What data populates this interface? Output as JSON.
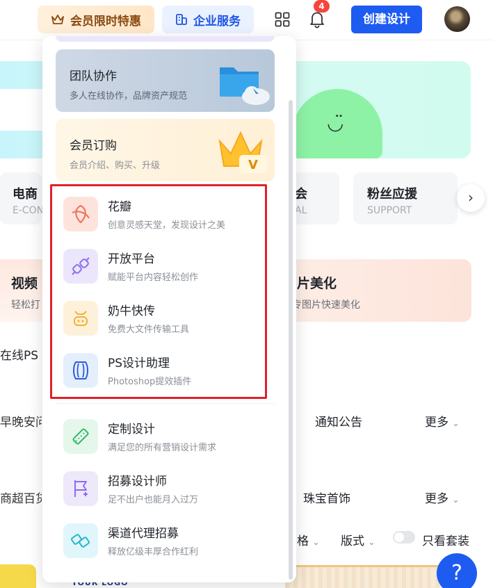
{
  "header": {
    "vip_label": "会员限时特惠",
    "enterprise_label": "企业服务",
    "notification_count": "4",
    "create_label": "创建设计"
  },
  "background": {
    "categories": [
      {
        "title": "电商",
        "sub": "E-CON"
      },
      {
        "title": "会",
        "sub": "AL"
      },
      {
        "title": "粉丝应援",
        "sub": "SUPPORT"
      }
    ],
    "promo_left_title": "视频",
    "promo_left_sub": "轻松打",
    "promo_right_title": "片美化",
    "promo_right_sub": "专图片快速美化",
    "online_ps": "在线PS",
    "row1_left": "早晚安问候",
    "row1_right": "通知公告",
    "row1_more": "更多",
    "row2_left": "商超百货",
    "row2_right": "珠宝首饰",
    "row2_more": "更多",
    "filter_1": "格",
    "filter_2": "版式",
    "only_set": "只看套装",
    "thumb_logo": "YOUR LOGO"
  },
  "dropdown": {
    "banners": [
      {
        "title": "团队协作",
        "sub": "多人在线协作，品牌资产规范"
      },
      {
        "title": "会员订购",
        "sub": "会员介绍、购买、升级"
      }
    ],
    "highlighted_items": [
      {
        "title": "花瓣",
        "sub": "创意灵感天堂，发现设计之美",
        "icon": "petal-icon"
      },
      {
        "title": "开放平台",
        "sub": "赋能平台内容轻松创作",
        "icon": "plug-icon"
      },
      {
        "title": "奶牛快传",
        "sub": "免费大文件传输工具",
        "icon": "cow-icon"
      },
      {
        "title": "PS设计助理",
        "sub": "Photoshop提效插件",
        "icon": "ps-assistant-icon"
      }
    ],
    "items": [
      {
        "title": "定制设计",
        "sub": "满足您的所有营销设计需求",
        "icon": "custom-design-icon"
      },
      {
        "title": "招募设计师",
        "sub": "足不出户也能月入过万",
        "icon": "flag-plus-icon"
      },
      {
        "title": "渠道代理招募",
        "sub": "释放亿级丰厚合作红利",
        "icon": "handshake-icon"
      }
    ]
  },
  "help_label": "?"
}
